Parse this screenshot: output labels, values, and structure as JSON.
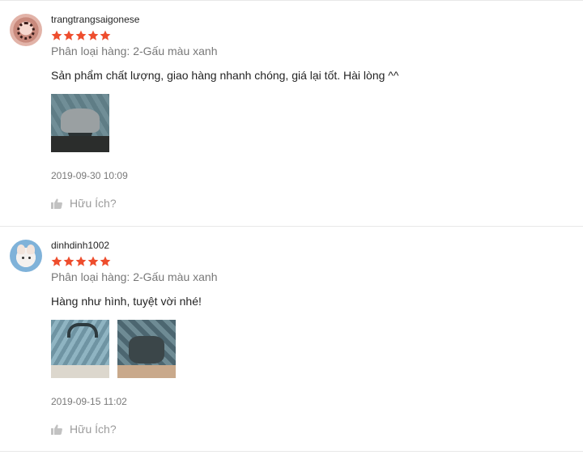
{
  "colors": {
    "star": "#ee4d2d",
    "divider": "#e8e8e8",
    "muted_text": "#8a8a8a",
    "thumb_icon": "#c2c2c2"
  },
  "reviews": [
    {
      "username": "trangtrangsaigonese",
      "rating": 5,
      "max_rating": 5,
      "variation": "Phân loại hàng: 2-Gấu màu xanh",
      "comment": "Sản phẩm chất lượng, giao hàng nhanh chóng, giá lại tốt. Hài lòng ^^",
      "photo_count": 1,
      "timestamp": "2019-09-30 10:09",
      "helpful_label": "Hữu Ích?",
      "helpful_icon": "thumbs-up-icon"
    },
    {
      "username": "dinhdinh1002",
      "rating": 5,
      "max_rating": 5,
      "variation": "Phân loại hàng: 2-Gấu màu xanh",
      "comment": "Hàng như hình, tuyệt vời nhé!",
      "photo_count": 2,
      "timestamp": "2019-09-15 11:02",
      "helpful_label": "Hữu Ích?",
      "helpful_icon": "thumbs-up-icon"
    }
  ]
}
